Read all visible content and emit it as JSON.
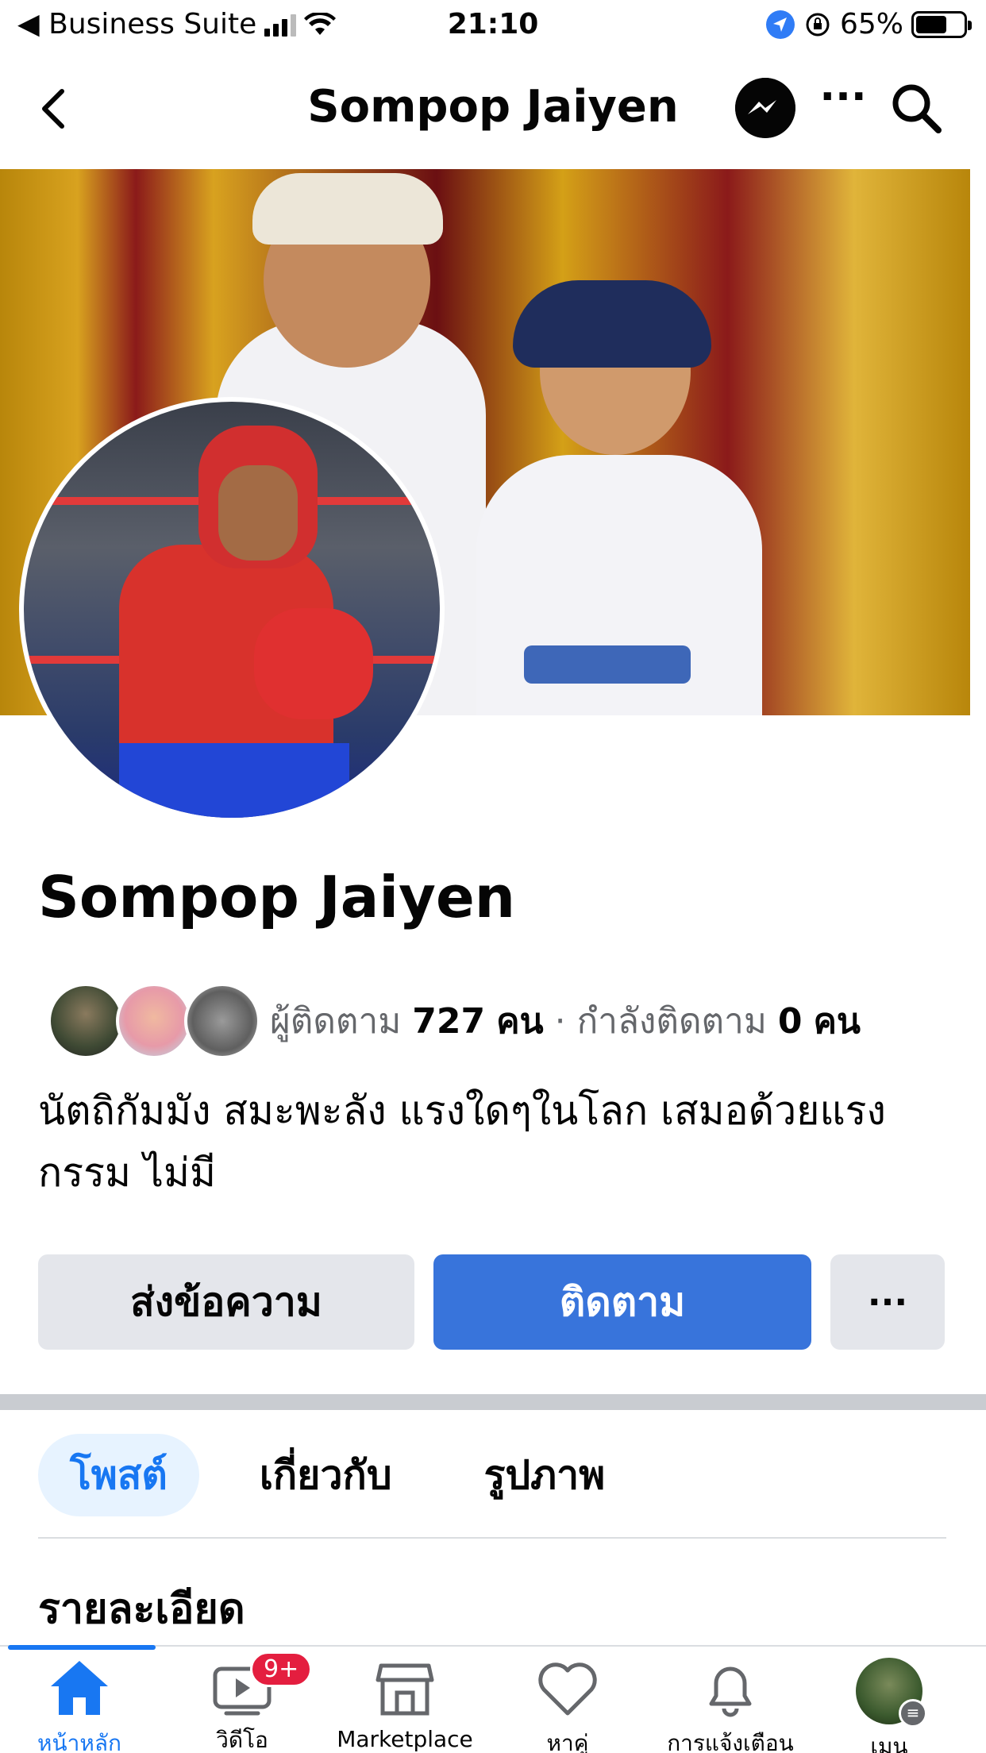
{
  "status_bar": {
    "back_app": "◀ Business Suite",
    "time": "21:10",
    "battery": "65%",
    "battery_level": 0.65
  },
  "header": {
    "title": "Sompop Jaiyen",
    "more_label": "···"
  },
  "profile": {
    "name": "Sompop Jaiyen",
    "followers_label": "ผู้ติดตาม",
    "followers_count": "727",
    "followers_unit": "คน",
    "separator": "·",
    "following_label": "กำลังติดตาม",
    "following_count": "0",
    "following_unit": "คน",
    "bio": "นัตถิกัมมัง สมะพะลัง แรงใดๆในโลก เสมอด้วยแรงกรรม ไม่มี"
  },
  "actions": {
    "message": "ส่งข้อความ",
    "follow": "ติดตาม",
    "more": "···"
  },
  "tabs": [
    {
      "label": "โพสต์",
      "active": true
    },
    {
      "label": "เกี่ยวกับ",
      "active": false
    },
    {
      "label": "รูปภาพ",
      "active": false
    }
  ],
  "section": {
    "title": "รายละเอียด"
  },
  "bottom_nav": {
    "items": [
      {
        "label": "หน้าหลัก",
        "icon": "home-icon",
        "active": true
      },
      {
        "label": "วิดีโอ",
        "icon": "video-icon",
        "badge": "9+"
      },
      {
        "label": "Marketplace",
        "icon": "marketplace-icon"
      },
      {
        "label": "หาคู่",
        "icon": "dating-heart-icon"
      },
      {
        "label": "การแจ้งเตือน",
        "icon": "bell-icon"
      },
      {
        "label": "เมนู",
        "icon": "menu-avatar-icon"
      }
    ]
  },
  "colors": {
    "accent": "#1877f2",
    "follow_button": "#3874db",
    "secondary_button": "#e4e6eb",
    "badge": "#e41e3f"
  }
}
